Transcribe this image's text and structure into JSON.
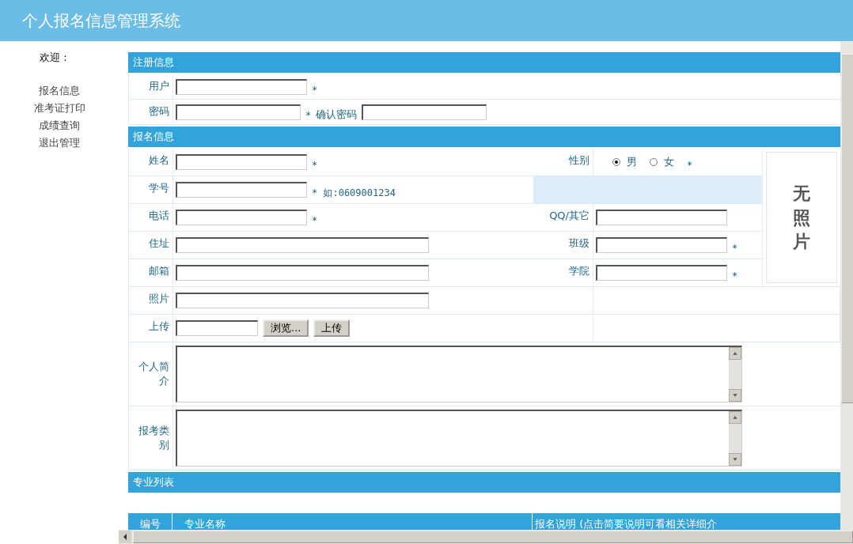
{
  "header": {
    "title": "个人报名信息管理系统"
  },
  "sidebar": {
    "welcome": "欢迎：",
    "items": [
      {
        "label": "报名信息"
      },
      {
        "label": "准考证打印"
      },
      {
        "label": "成绩查询"
      },
      {
        "label": "退出管理"
      }
    ]
  },
  "register": {
    "title": "注册信息",
    "user": {
      "label": "用户",
      "note": "*"
    },
    "password": {
      "label": "密码",
      "note": "*"
    },
    "confirm": {
      "label": "确认密码"
    }
  },
  "signup": {
    "title": "报名信息",
    "photo": {
      "text": "无照片"
    },
    "rows": [
      {
        "left": {
          "kind": "short",
          "label": "姓名",
          "note": "*"
        },
        "right": {
          "kind": "radio",
          "label": "性别",
          "options": [
            {
              "label": "男",
              "selected": true
            },
            {
              "label": "女",
              "selected": false
            }
          ],
          "note": "*"
        }
      },
      {
        "left": {
          "kind": "short",
          "label": "学号",
          "note": "* 如:0609001234"
        },
        "right": {
          "kind": "blank"
        }
      },
      {
        "left": {
          "kind": "short",
          "label": "电话",
          "note": "*"
        },
        "right": {
          "kind": "text",
          "label": "QQ/其它"
        }
      },
      {
        "left": {
          "kind": "long",
          "label": "住址"
        },
        "right": {
          "kind": "text",
          "label": "班级",
          "note": "*"
        }
      },
      {
        "left": {
          "kind": "long",
          "label": "邮箱"
        },
        "right": {
          "kind": "text",
          "label": "学院",
          "note": "*"
        }
      },
      {
        "left": {
          "kind": "long",
          "label": "照片"
        },
        "right": {
          "kind": "none"
        }
      },
      {
        "left": {
          "kind": "upload",
          "label": "上传",
          "browse": "浏览...",
          "upload": "上传"
        },
        "right": {
          "kind": "none"
        }
      }
    ],
    "textareas": [
      {
        "label": "个人简介"
      },
      {
        "label": "报考类别"
      }
    ]
  },
  "majors": {
    "title": "专业列表",
    "columns": [
      "编号",
      "专业名称",
      "报名说明 (点击简要说明可看相关详细介"
    ]
  }
}
